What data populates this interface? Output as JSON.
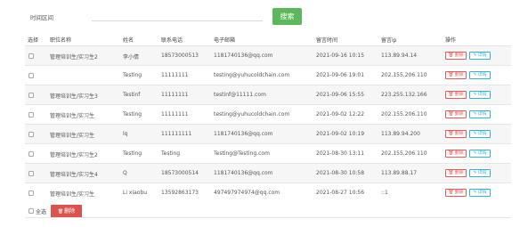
{
  "search": {
    "label": "时间区间",
    "placeholder": "",
    "button": "搜索"
  },
  "table": {
    "headers": {
      "select": "选择",
      "position": "职位名称",
      "name": "姓名",
      "phone": "联系电话",
      "email": "电子邮箱",
      "time": "留言时间",
      "ip": "留言ip",
      "ops": "操作"
    },
    "delete_label": "删除",
    "detail_label": "详情",
    "rows": [
      {
        "position": "管理培训生/实习生2",
        "name": "李小倩",
        "phone": "18573000513",
        "email": "1181740136@qq.com",
        "time": "2021-09-16 10:15",
        "ip": "113.89.94.14"
      },
      {
        "position": "",
        "name": "Testing",
        "phone": "11111111",
        "email": "testing@yuhucoldchain.com",
        "time": "2021-09-06 19:01",
        "ip": "202.155.206.110"
      },
      {
        "position": "管理培训生/实习生3",
        "name": "Testinf",
        "phone": "11111111",
        "email": "testinf@11111.com",
        "time": "2021-09-06 15:55",
        "ip": "223.255.132.166"
      },
      {
        "position": "管理培训生/实习生",
        "name": "Testing",
        "phone": "11111111",
        "email": "testing@yuhucoldchain.com",
        "time": "2021-09-02 12:22",
        "ip": "202.155.206.110"
      },
      {
        "position": "管理培训生/实习生",
        "name": "lq",
        "phone": "111111111",
        "email": "1181740136@qq.com",
        "time": "2021-09-02 10:19",
        "ip": "113.89.94.200"
      },
      {
        "position": "管理培训生/实习生2",
        "name": "Testing",
        "phone": "Testing",
        "email": "Testing@Testing.com",
        "time": "2021-08-30 13:11",
        "ip": "202.155.206.110"
      },
      {
        "position": "管理培训生/实习生4",
        "name": "Q",
        "phone": "18573000514",
        "email": "1181740136@qq.com",
        "time": "2021-08-30 10:58",
        "ip": "113.89.88.17"
      },
      {
        "position": "管理培训生/实习生",
        "name": "Li xiaobu",
        "phone": "13592863173",
        "email": "497497974974@qq.com",
        "time": "2021-08-27 10:56",
        "ip": "::1"
      }
    ]
  },
  "footer": {
    "select_all": "全选",
    "bulk_delete": "删除"
  },
  "colors": {
    "search_button": "#5cb85c",
    "delete_red": "#d9534f",
    "detail_blue": "#35b3d6"
  }
}
